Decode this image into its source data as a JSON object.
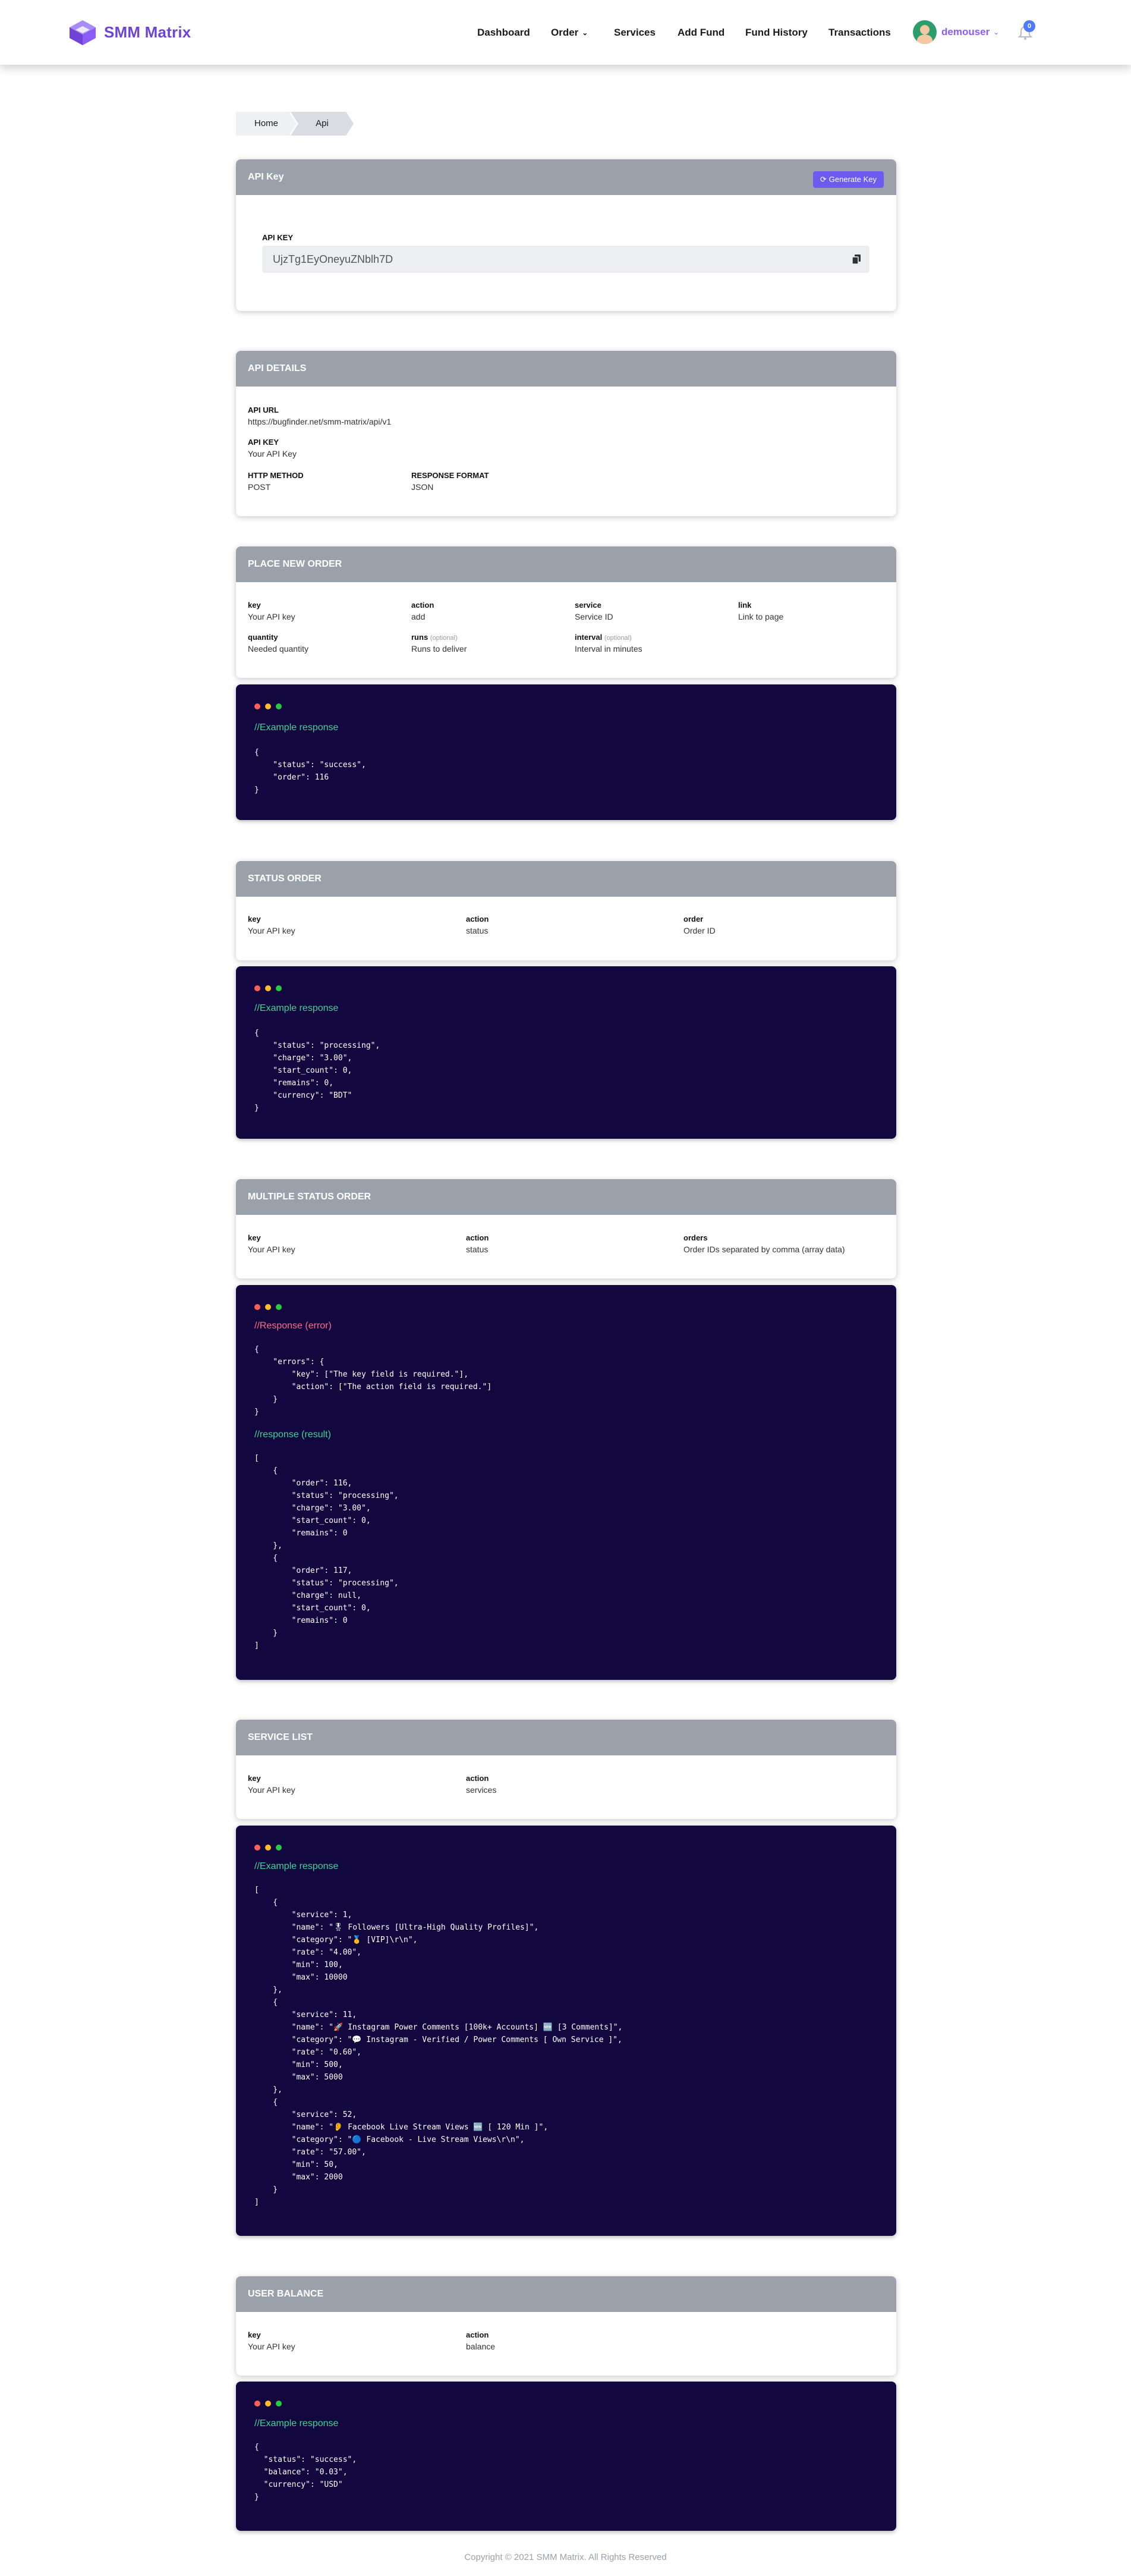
{
  "app": {
    "name": "SMM Matrix"
  },
  "nav": {
    "items": [
      "Dashboard",
      "Order",
      "Services",
      "Add Fund",
      "Fund History",
      "Transactions"
    ],
    "user": "demouser",
    "notifications": "0"
  },
  "breadcrumb": {
    "home": "Home",
    "current": "Api"
  },
  "api_key_card": {
    "title": "API Key",
    "generate_button": "Generate Key",
    "label": "API KEY",
    "value": "UjzTg1EyOneyuZNblh7D"
  },
  "api_details": {
    "title": "API DETAILS",
    "url_label": "API URL",
    "url_value": "https://bugfinder.net/smm-matrix/api/v1",
    "key_label": "API KEY",
    "key_value": "Your API Key",
    "method_label": "HTTP METHOD",
    "method_value": "POST",
    "format_label": "RESPONSE FORMAT",
    "format_value": "JSON"
  },
  "place_order": {
    "title": "PLACE NEW ORDER",
    "params": [
      {
        "label": "key",
        "value": "Your API key"
      },
      {
        "label": "action",
        "value": "add"
      },
      {
        "label": "service",
        "value": "Service ID"
      },
      {
        "label": "link",
        "value": "Link to page"
      },
      {
        "label": "quantity",
        "value": "Needed quantity"
      },
      {
        "label": "runs",
        "optional": "(optional)",
        "value": "Runs to deliver"
      },
      {
        "label": "interval",
        "optional": "(optional)",
        "value": "Interval in minutes"
      }
    ],
    "response_title": "//Example response",
    "response_code": "{\n    \"status\": \"success\",\n    \"order\": 116\n}"
  },
  "status_order": {
    "title": "STATUS ORDER",
    "params": [
      {
        "label": "key",
        "value": "Your API key"
      },
      {
        "label": "action",
        "value": "status"
      },
      {
        "label": "order",
        "value": "Order ID"
      }
    ],
    "response_title": "//Example response",
    "response_code": "{\n    \"status\": \"processing\",\n    \"charge\": \"3.00\",\n    \"start_count\": 0,\n    \"remains\": 0,\n    \"currency\": \"BDT\"\n}"
  },
  "multiple_status": {
    "title": "MULTIPLE STATUS ORDER",
    "params": [
      {
        "label": "key",
        "value": "Your API key"
      },
      {
        "label": "action",
        "value": "status"
      },
      {
        "label": "orders",
        "value": "Order IDs separated by comma (array data)"
      }
    ],
    "error_title": "//Response (error)",
    "error_code": "{\n    \"errors\": {\n        \"key\": [\"The key field is required.\"],\n        \"action\": [\"The action field is required.\"]\n    }\n}",
    "result_title": "//response (result)",
    "result_code": "[\n    {\n        \"order\": 116,\n        \"status\": \"processing\",\n        \"charge\": \"3.00\",\n        \"start_count\": 0,\n        \"remains\": 0\n    },\n    {\n        \"order\": 117,\n        \"status\": \"processing\",\n        \"charge\": null,\n        \"start_count\": 0,\n        \"remains\": 0\n    }\n]"
  },
  "service_list": {
    "title": "SERVICE LIST",
    "params": [
      {
        "label": "key",
        "value": "Your API key"
      },
      {
        "label": "action",
        "value": "services"
      }
    ],
    "response_title": "//Example response",
    "response_code": "[\n    {\n        \"service\": 1,\n        \"name\": \"🎖 Followers [Ultra-High Quality Profiles]\",\n        \"category\": \"🥇 [VIP]\\r\\n\",\n        \"rate\": \"4.00\",\n        \"min\": 100,\n        \"max\": 10000\n    },\n    {\n        \"service\": 11,\n        \"name\": \"🚀 Instagram Power Comments [100k+ Accounts] 🆕 [3 Comments]\",\n        \"category\": \"💬 Instagram - Verified / Power Comments [ Own Service ]\",\n        \"rate\": \"0.60\",\n        \"min\": 500,\n        \"max\": 5000\n    },\n    {\n        \"service\": 52,\n        \"name\": \"👂 Facebook Live Stream Views 🆕 [ 120 Min ]\",\n        \"category\": \"🔵 Facebook - Live Stream Views\\r\\n\",\n        \"rate\": \"57.00\",\n        \"min\": 50,\n        \"max\": 2000\n    }\n]"
  },
  "user_balance": {
    "title": "USER BALANCE",
    "params": [
      {
        "label": "key",
        "value": "Your API key"
      },
      {
        "label": "action",
        "value": "balance"
      }
    ],
    "response_title": "//Example response",
    "response_code": "{\n  \"status\": \"success\",\n  \"balance\": \"0.03\",\n  \"currency\": \"USD\"\n}"
  },
  "footer": {
    "text": "Copyright © 2021 SMM Matrix. All Rights Reserved"
  },
  "colors": {
    "accent": "#6d5bf0",
    "brand": "#6f43d6",
    "code_bg": "#12073f",
    "card_head": "#9ba1ab"
  }
}
